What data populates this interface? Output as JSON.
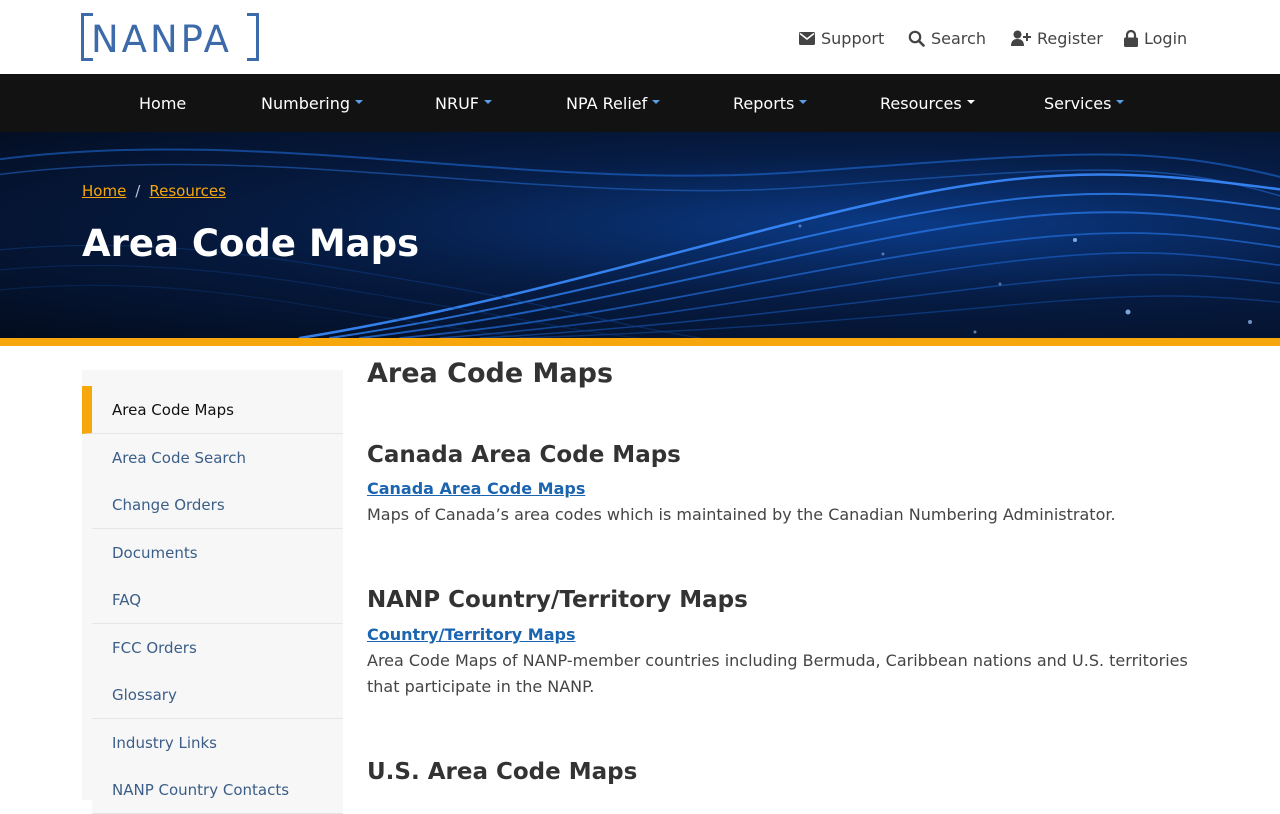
{
  "logo": {
    "text": "NANPA"
  },
  "utility_nav": [
    {
      "label": "Support",
      "icon": "envelope-icon"
    },
    {
      "label": "Search",
      "icon": "search-icon"
    },
    {
      "label": "Register",
      "icon": "user-plus-icon"
    },
    {
      "label": "Login",
      "icon": "lock-icon"
    }
  ],
  "main_nav": [
    {
      "label": "Home",
      "dropdown": false
    },
    {
      "label": "Numbering",
      "dropdown": true
    },
    {
      "label": "NRUF",
      "dropdown": true
    },
    {
      "label": "NPA Relief",
      "dropdown": true
    },
    {
      "label": "Reports",
      "dropdown": true
    },
    {
      "label": "Resources",
      "dropdown": true
    },
    {
      "label": "Services",
      "dropdown": true
    }
  ],
  "breadcrumb": {
    "items": [
      "Home",
      "Resources"
    ],
    "separator": "/"
  },
  "hero": {
    "title": "Area Code Maps"
  },
  "sidebar": {
    "items": [
      {
        "label": "Area Code Maps",
        "active": true
      },
      {
        "label": "Area Code Search",
        "active": false
      },
      {
        "label": "Change Orders",
        "active": false
      },
      {
        "label": "Documents",
        "active": false
      },
      {
        "label": "FAQ",
        "active": false
      },
      {
        "label": "FCC Orders",
        "active": false
      },
      {
        "label": "Glossary",
        "active": false
      },
      {
        "label": "Industry Links",
        "active": false
      },
      {
        "label": "NANP Country Contacts",
        "active": false
      }
    ]
  },
  "content": {
    "title": "Area Code Maps",
    "sections": [
      {
        "heading": "Canada Area Code Maps",
        "link": "Canada Area Code Maps",
        "description": "Maps of Canada’s area codes which is maintained by the Canadian Numbering Administrator."
      },
      {
        "heading": "NANP Country/Territory Maps",
        "link": "Country/Territory Maps",
        "description": "Area Code Maps of NANP-member countries including Bermuda, Caribbean nations and U.S. territories that participate in the NANP."
      },
      {
        "heading": "U.S. Area Code Maps"
      }
    ]
  },
  "colors": {
    "brand_blue": "#3d6aa8",
    "accent_orange": "#f6a70b",
    "nav_bg": "#121212",
    "link_blue": "#1a64b0"
  }
}
